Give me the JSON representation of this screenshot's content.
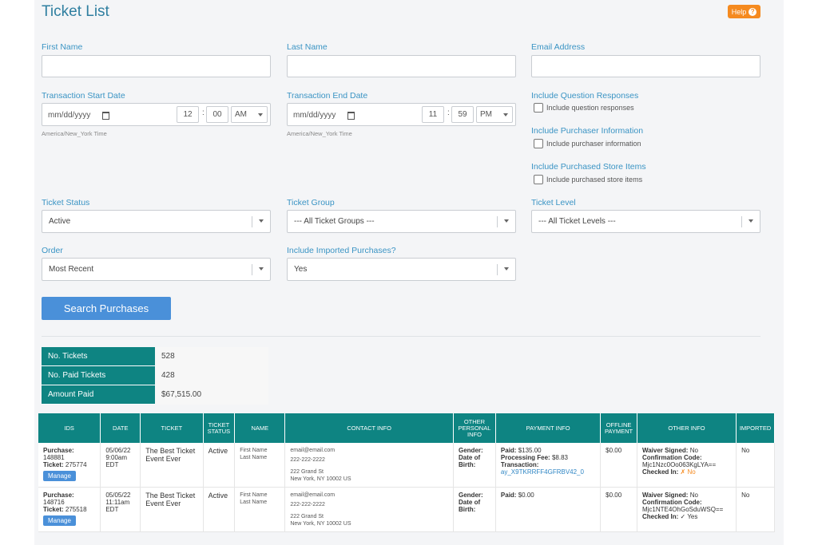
{
  "page_title": "Ticket List",
  "help_label": "Help",
  "filters": {
    "first_name_label": "First Name",
    "last_name_label": "Last Name",
    "email_label": "Email Address",
    "start_label": "Transaction Start Date",
    "start_date": "mm/dd/yyyy",
    "start_hour": "12",
    "start_min": "00",
    "start_ampm": "AM",
    "start_tz": "America/New_York Time",
    "end_label": "Transaction End Date",
    "end_date": "mm/dd/yyyy",
    "end_hour": "11",
    "end_min": "59",
    "end_ampm": "PM",
    "end_tz": "America/New_York Time",
    "q_label": "Include Question Responses",
    "q_cb": "Include question responses",
    "p_label": "Include Purchaser Information",
    "p_cb": "Include purchaser information",
    "s_label": "Include Purchased Store Items",
    "s_cb": "Include purchased store items",
    "status_label": "Ticket Status",
    "status_val": "Active",
    "group_label": "Ticket Group",
    "group_val": "--- All Ticket Groups ---",
    "level_label": "Ticket Level",
    "level_val": "--- All Ticket Levels ---",
    "order_label": "Order",
    "order_val": "Most Recent",
    "imported_label": "Include Imported Purchases?",
    "imported_val": "Yes",
    "search_btn": "Search Purchases"
  },
  "summary": [
    {
      "k": "No. Tickets",
      "v": "528"
    },
    {
      "k": "No. Paid Tickets",
      "v": "428"
    },
    {
      "k": "Amount Paid",
      "v": "$67,515.00"
    }
  ],
  "table": {
    "headers": [
      "IDS",
      "DATE",
      "TICKET",
      "TICKET STATUS",
      "NAME",
      "CONTACT INFO",
      "OTHER PERSONAL INFO",
      "PAYMENT INFO",
      "OFFLINE PAYMENT",
      "OTHER INFO",
      "IMPORTED"
    ],
    "rows": [
      {
        "purchase_label": "Purchase:",
        "purchase": "148881",
        "ticket_label": "Ticket:",
        "ticket": "275774",
        "manage": "Manage",
        "date1": "05/06/22",
        "date2": "9:00am",
        "date3": "EDT",
        "event": "The Best Ticket Event Ever",
        "status": "Active",
        "first": "First Name",
        "last": "Last Name",
        "email": "email@email.com",
        "phone": "222-222-2222",
        "addr1": "222 Grand St",
        "addr2": "New York, NY 10002 US",
        "gender": "Gender:",
        "dob": "Date of Birth:",
        "paid_label": "Paid:",
        "paid": "$135.00",
        "fee_label": "Processing Fee:",
        "fee": "$8.83",
        "trans_label": "Transaction:",
        "trans": "ay_X9TKRRFF4GFRBV42_0",
        "offline": "$0.00",
        "waiver_label": "Waiver Signed:",
        "waiver": "No",
        "conf_label": "Confirmation Code:",
        "conf": "Mjc1Nzc0Oo063KgLYA==",
        "checked_label": "Checked In:",
        "checked": "✗ No",
        "imported": "No"
      },
      {
        "purchase_label": "Purchase:",
        "purchase": "148716",
        "ticket_label": "Ticket:",
        "ticket": "275518",
        "manage": "Manage",
        "date1": "05/05/22",
        "date2": "11:11am",
        "date3": "EDT",
        "event": "The Best Ticket Event Ever",
        "status": "Active",
        "first": "First Name",
        "last": "Last Name",
        "email": "email@email.com",
        "phone": "222-222-2222",
        "addr1": "222 Grand St",
        "addr2": "New York, NY 10002 US",
        "gender": "Gender:",
        "dob": "Date of Birth:",
        "paid_label": "Paid:",
        "paid": "$0.00",
        "offline": "$0.00",
        "waiver_label": "Waiver Signed:",
        "waiver": "No",
        "conf_label": "Confirmation Code:",
        "conf": "Mjc1NTE4OhGoSduWSQ==",
        "checked_label": "Checked In:",
        "checked": "✓ Yes",
        "imported": "No"
      }
    ]
  }
}
